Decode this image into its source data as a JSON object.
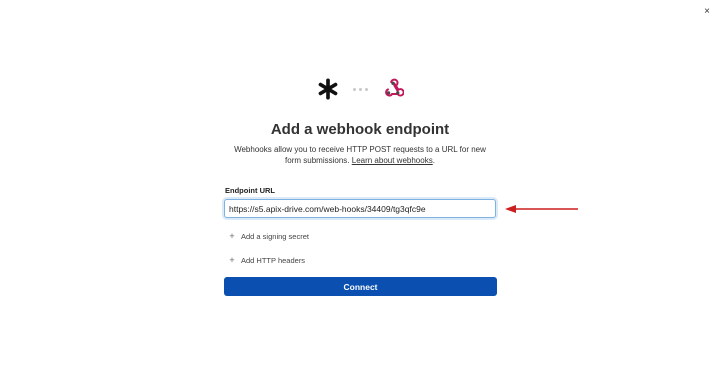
{
  "dialog": {
    "close_glyph": "×",
    "title": "Add a webhook endpoint",
    "description": "Webhooks allow you to receive HTTP POST requests to a URL for new form submissions.",
    "learn_link": "Learn about webhooks",
    "learn_suffix": "."
  },
  "logos": {
    "left_icon": "asterisk-logo-icon",
    "right_icon": "webhook-icon",
    "connector": "dots-connector"
  },
  "endpoint": {
    "label": "Endpoint URL",
    "value": "https://s5.apix-drive.com/web-hooks/34409/tg3qfc9e"
  },
  "options": [
    {
      "icon": "plus-icon",
      "label": "Add a signing secret"
    },
    {
      "icon": "plus-icon",
      "label": "Add HTTP headers"
    }
  ],
  "actions": {
    "connect_label": "Connect"
  },
  "colors": {
    "primary_button": "#0b4fb0",
    "annotation_arrow": "#cc1f1f",
    "input_focus": "#7fb2e0",
    "webhook_icon": "#c2185b"
  }
}
